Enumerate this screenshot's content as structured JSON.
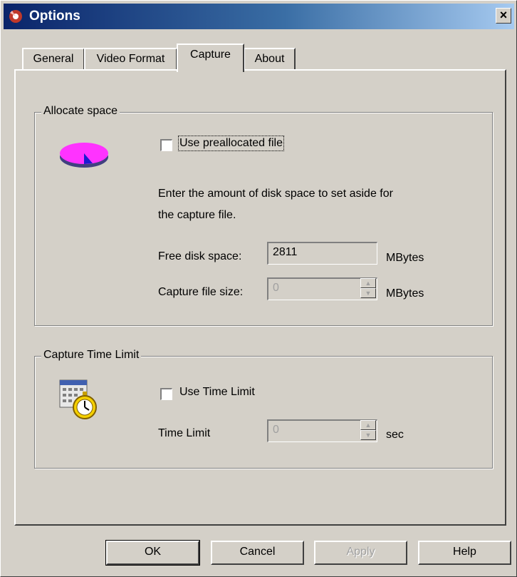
{
  "window": {
    "title": "Options",
    "close_symbol": "×"
  },
  "tabs": [
    {
      "label": "General",
      "active": false
    },
    {
      "label": "Video Format",
      "active": false
    },
    {
      "label": "Capture",
      "active": true
    },
    {
      "label": "About",
      "active": false
    }
  ],
  "allocate": {
    "group_label": "Allocate space",
    "icon": "disk-pie-icon",
    "use_preallocated_label": "Use preallocated file",
    "use_preallocated_checked": false,
    "description_line1": "Enter the amount of disk space to set aside for",
    "description_line2": "the capture file.",
    "free_space_label": "Free disk space:",
    "free_space_value": "2811",
    "free_space_unit": "MBytes",
    "file_size_label": "Capture file size:",
    "file_size_value": "0",
    "file_size_unit": "MBytes"
  },
  "time_limit": {
    "group_label": "Capture Time Limit",
    "icon": "calendar-stopwatch-icon",
    "use_time_limit_label": "Use Time Limit",
    "use_time_limit_checked": false,
    "time_limit_label": "Time Limit",
    "time_limit_value": "0",
    "time_limit_unit": "sec"
  },
  "buttons": {
    "ok": "OK",
    "cancel": "Cancel",
    "apply": "Apply",
    "help": "Help"
  }
}
